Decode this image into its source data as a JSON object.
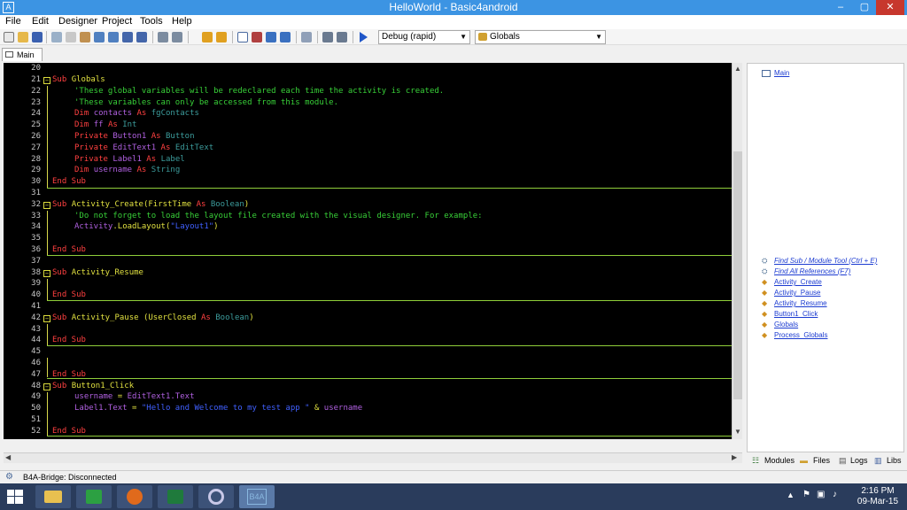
{
  "window": {
    "title": "HelloWorld - Basic4android",
    "app_icon": "A",
    "min": "–",
    "max": "▢",
    "close": "✕"
  },
  "menu": [
    "File",
    "Edit",
    "Designer",
    "Project",
    "Tools",
    "Help"
  ],
  "toolbar": {
    "build_mode": "Debug (rapid)",
    "sub_select": "Globals"
  },
  "tab": {
    "label": "Main"
  },
  "code": {
    "numbers": [
      "20",
      "21",
      "22",
      "23",
      "24",
      "25",
      "26",
      "27",
      "28",
      "29",
      "30",
      "31",
      "32",
      "33",
      "34",
      "35",
      "36",
      "37",
      "38",
      "39",
      "40",
      "41",
      "42",
      "43",
      "44",
      "45",
      "46",
      "47",
      "48",
      "49",
      "50",
      "51",
      "52"
    ],
    "l21": [
      "Sub ",
      "Globals"
    ],
    "l22": "'These global variables will be redeclared each time the activity is created.",
    "l23": "'These variables can only be accessed from this module.",
    "l24": [
      "Dim ",
      "contacts ",
      "As ",
      "fgContacts"
    ],
    "l25": [
      "Dim ",
      "ff ",
      "As ",
      "Int"
    ],
    "l26": [
      "Private ",
      "Button1 ",
      "As ",
      "Button"
    ],
    "l27": [
      "Private ",
      "EditText1 ",
      "As ",
      "EditText"
    ],
    "l28": [
      "Private ",
      "Label1 ",
      "As ",
      "Label"
    ],
    "l29": [
      "Dim ",
      "username ",
      "As ",
      "String"
    ],
    "end_sub": "End Sub",
    "l32": [
      "Sub ",
      "Activity_Create",
      "(FirstTime ",
      "As ",
      "Boolean",
      ")"
    ],
    "l33": "'Do not forget to load the layout file created with the visual designer. For example:",
    "l34": [
      "Activity",
      ".LoadLayout(",
      "\"Layout1\"",
      ")"
    ],
    "l38": [
      "Sub ",
      "Activity_Resume"
    ],
    "l42": [
      "Sub ",
      "Activity_Pause ",
      "(UserClosed ",
      "As ",
      "Boolean",
      ")"
    ],
    "l48": [
      "Sub ",
      "Button1_Click"
    ],
    "l49": [
      "username ",
      "= ",
      "EditText1.Text"
    ],
    "l50": [
      "Label1.Text ",
      "= ",
      "\"Hello and Welcome to my test app \"",
      " & ",
      "username"
    ]
  },
  "right_panel": {
    "top_link": "Main",
    "links": [
      "Find Sub / Module Tool (Ctrl + E)",
      "Find All References (F7)",
      "Activity_Create",
      "Activity_Pause",
      "Activity_Resume",
      "Button1_Click",
      "Globals",
      "Process_Globals"
    ]
  },
  "bottom_tabs": [
    "Modules",
    "Files",
    "Logs",
    "Libs"
  ],
  "status": "B4A-Bridge: Disconnected",
  "taskbar": {
    "time": "2:16 PM",
    "date": "09-Mar-15",
    "b4a_label": "B4A"
  }
}
